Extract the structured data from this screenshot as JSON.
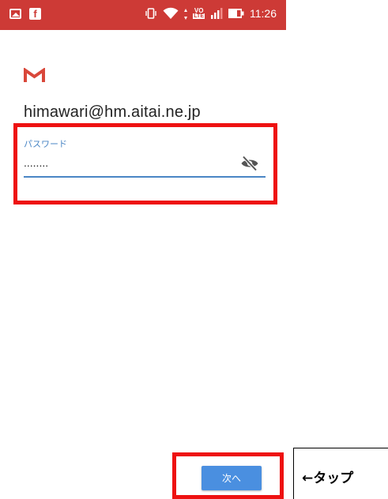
{
  "status_bar": {
    "time": "11:26",
    "left_icons": [
      "image-icon",
      "facebook-icon"
    ],
    "right_icons": [
      "vibrate-icon",
      "wifi-icon",
      "volte-icon",
      "signal-icon",
      "battery-icon"
    ],
    "volte_top": "VO",
    "volte_bottom": "LTE",
    "facebook_glyph": "f",
    "color": "#cd3a36"
  },
  "login": {
    "logo": "gmail-icon",
    "account_email": "himawari@hm.aitai.ne.jp",
    "password_label": "パスワード",
    "password_value": "........",
    "visibility_toggle": "eye-off-icon",
    "next_button": "次へ",
    "accent_color": "#4a86c5"
  },
  "annotation": {
    "tap_label": "←タップ",
    "highlight_color": "#ee1111"
  }
}
